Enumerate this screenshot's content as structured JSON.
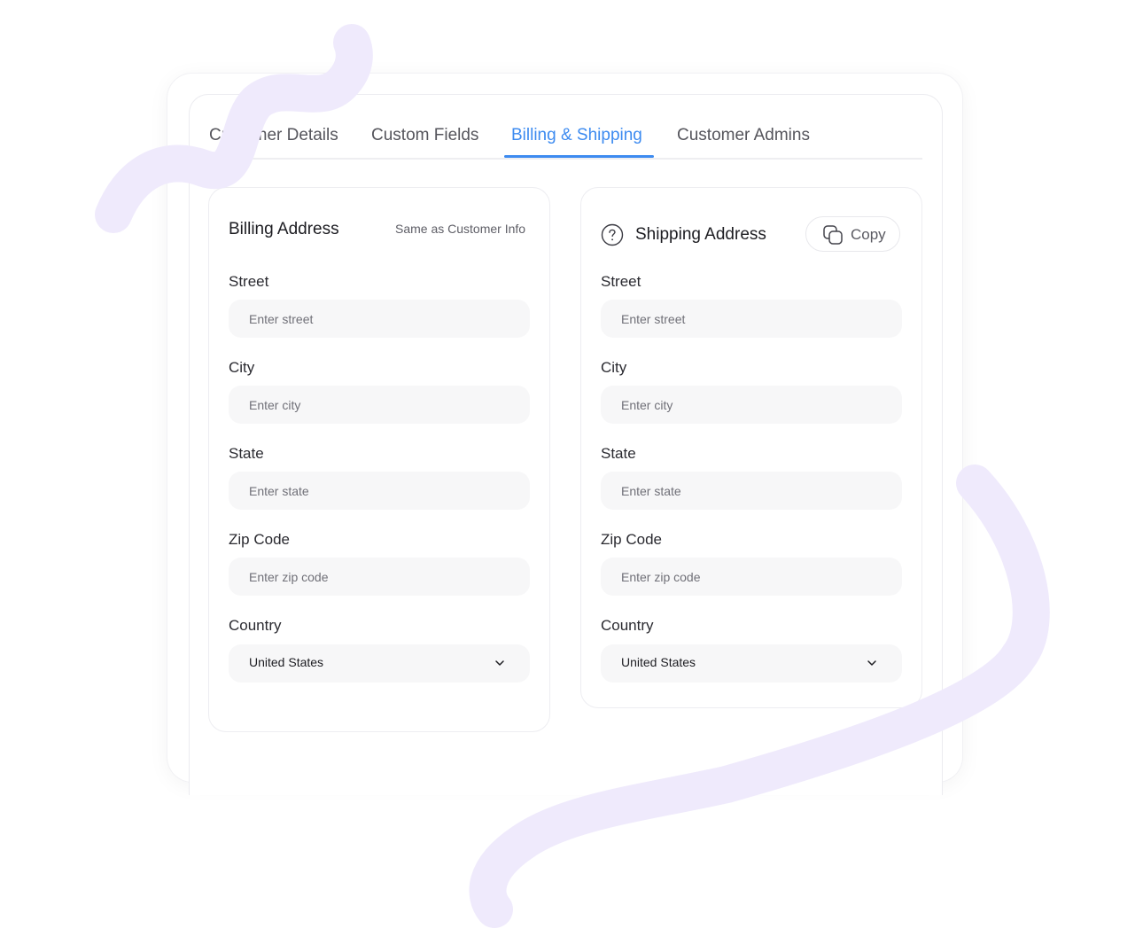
{
  "tabs": [
    {
      "label": "Customer Details",
      "active": false
    },
    {
      "label": "Custom Fields",
      "active": false
    },
    {
      "label": "Billing & Shipping",
      "active": true
    },
    {
      "label": "Customer Admins",
      "active": false
    }
  ],
  "billing": {
    "title": "Billing Address",
    "same_as_link": "Same as Customer Info",
    "street_label": "Street",
    "street_placeholder": "Enter street",
    "city_label": "City",
    "city_placeholder": "Enter city",
    "state_label": "State",
    "state_placeholder": "Enter state",
    "zip_label": "Zip Code",
    "zip_placeholder": "Enter zip code",
    "country_label": "Country",
    "country_value": "United States"
  },
  "shipping": {
    "title": "Shipping Address",
    "help_icon": "question-circle-icon",
    "copy_label": "Copy",
    "copy_icon": "copy-icon",
    "street_label": "Street",
    "street_placeholder": "Enter street",
    "city_label": "City",
    "city_placeholder": "Enter city",
    "state_label": "State",
    "state_placeholder": "Enter state",
    "zip_label": "Zip Code",
    "zip_placeholder": "Enter zip code",
    "country_label": "Country",
    "country_value": "United States"
  },
  "colors": {
    "accent": "#3d8bf0",
    "decoration": "#efeafc",
    "input_bg": "#f7f7f8"
  }
}
